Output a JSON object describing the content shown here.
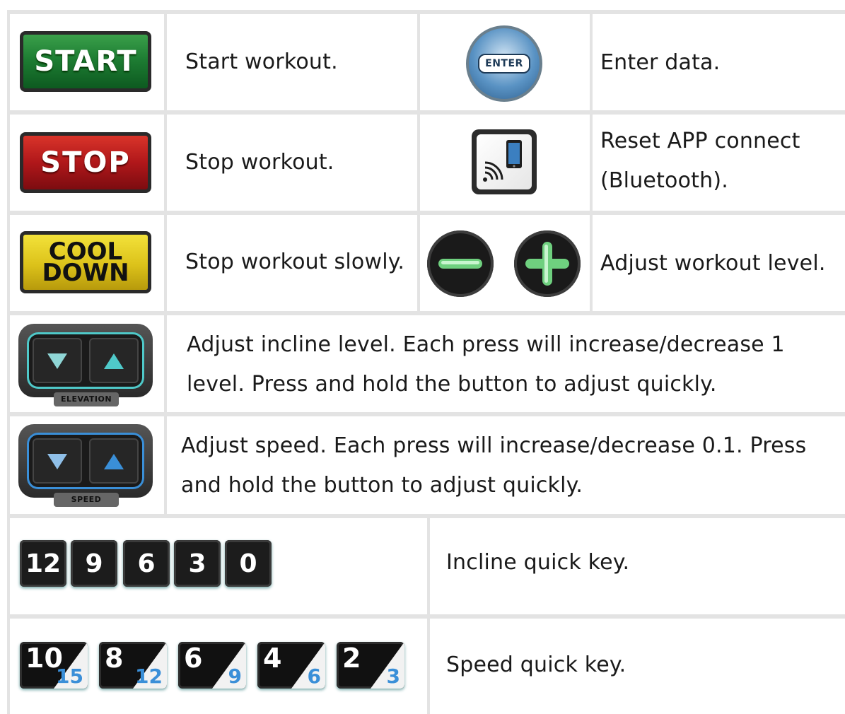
{
  "rows": {
    "start": {
      "key_label": "START",
      "desc": "Start workout."
    },
    "enter": {
      "key_label": "ENTER",
      "desc": "Enter data."
    },
    "stop": {
      "key_label": "STOP",
      "desc": "Stop workout."
    },
    "bluetooth": {
      "desc_line1": "Reset APP connect",
      "desc_line2": "(Bluetooth)."
    },
    "cooldown": {
      "key_line1": "COOL",
      "key_line2": "DOWN",
      "desc": "Stop workout slowly."
    },
    "level": {
      "desc": "Adjust workout level."
    },
    "elevation": {
      "tag": "ELEVATION",
      "desc_line1": "Adjust incline level. Each press will increase/decrease 1",
      "desc_line2": "level. Press and hold the button to adjust quickly."
    },
    "speed": {
      "tag": "SPEED",
      "desc_line1": "Adjust speed. Each press will increase/decrease 0.1. Press",
      "desc_line2": "and hold the button to adjust quickly."
    },
    "incline_quick": {
      "keys": [
        "12",
        "9",
        "6",
        "3",
        "0"
      ],
      "desc": "Incline quick key."
    },
    "speed_quick": {
      "keys": [
        {
          "top": "10",
          "bottom": "15"
        },
        {
          "top": "8",
          "bottom": "12"
        },
        {
          "top": "6",
          "bottom": "9"
        },
        {
          "top": "4",
          "bottom": "6"
        },
        {
          "top": "2",
          "bottom": "3"
        }
      ],
      "desc": "Speed quick key."
    }
  },
  "colors": {
    "start": "#1e7d33",
    "stop": "#b0171a",
    "cooldown": "#dcc21a",
    "enter": "#5a93c4",
    "plus_minus_accent": "#6fd07f",
    "elevation_accent": "#4fc9c9",
    "speed_accent": "#3a8fd8"
  },
  "icons": {
    "bluetooth": "phone-bluetooth-icon",
    "minus": "minus-icon",
    "plus": "plus-icon",
    "down": "triangle-down-icon",
    "up": "triangle-up-icon"
  }
}
